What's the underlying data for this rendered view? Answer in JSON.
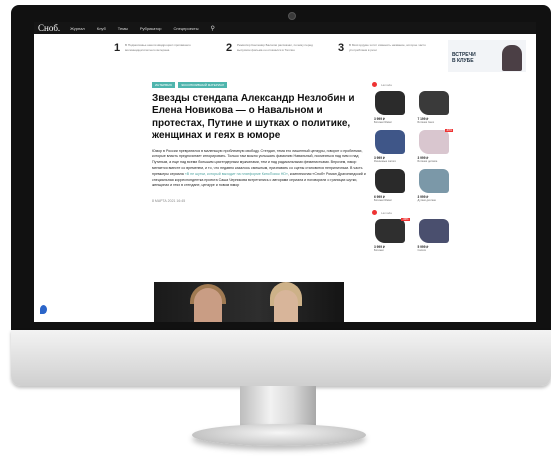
{
  "nav": {
    "logo": "Сноб.",
    "items": [
      "Журнал",
      "Клуб",
      "Темы",
      "Рубрикатор",
      "Спецпроекты"
    ]
  },
  "promo": [
    {
      "num": "1",
      "text": "В Подмосковье нашли квадроцикл пропавшего восемнадцатилетнего ветерана"
    },
    {
      "num": "2",
      "text": "Режиссёр Кантемир Балагов рассказал, почему перед выпуском фильма он отказался в Таллин"
    },
    {
      "num": "3",
      "text": "В Мосгордуме хотят изменить название, которое часто употребляем в речи"
    }
  ],
  "banner": {
    "text_line1": "ВСТРЕЧИ",
    "text_line2": "В КЛУБЕ"
  },
  "article": {
    "tags": [
      "ИНТЕРВЬЮ",
      "ЭКСКЛЮЗИВНЫЙ МАТЕРИАЛ"
    ],
    "headline": "Звезды стендапа Александр Незлобин и Елена Новикова — о Навальном и протестах, Путине и шутках о политике, женщинах и геях в юморе",
    "lead_part1": "Юмор в России превратился в маленькую проблемную свободу. Стендап, тема его лишенный цензуры, говорит о проблемах, которые власть предпочитает игнорировать. Только там можно услышать фамилию Навальный, посмеяться над ним и над Путиным, а еще над всеми большим цисгендерным мужчинами, тем и над радикальными феминистками. Впрочем, юмор меняется вместе со временем, и то, что недавно казалось смешным, признавать со сцены становится неприличным. В часть премьеры сериала ",
    "lead_link": "«В не шутки, который выходит на платформе КиноПоиск HD»",
    "lead_part2": ", комплексная «Сноб» Роман Драгоняндский и специальная корреспондентка проекта Саша Черникова встретились с авторами сериала и поговорили о границах шутки, женщинах и геях в стендапе, цензуре и новом юмор",
    "date": "8 МАРТА 2021 16:45"
  },
  "sidebar": {
    "store": "Lamoda",
    "shoes_top": [
      {
        "price": "3 999 ₽",
        "name": "Ботинки Rieker",
        "color": "#2b2b2b",
        "badge": ""
      },
      {
        "price": "7 199 ₽",
        "name": "Ботинки Geox",
        "color": "#3a3a3a",
        "badge": ""
      },
      {
        "price": "3 999 ₽",
        "name": "Резиновые сапоги",
        "color": "#3f5688",
        "badge": ""
      },
      {
        "price": "3 999 ₽",
        "name": "Ботинки детские",
        "color": "#d9c6cf",
        "badge": "-30%"
      },
      {
        "price": "6 999 ₽",
        "name": "Ботинки Rieker",
        "color": "#2a2a2a",
        "badge": ""
      },
      {
        "price": "3 999 ₽",
        "name": "Дутики детские",
        "color": "#7b98a8",
        "badge": ""
      }
    ],
    "shoes_bottom": [
      {
        "price": "3 999 ₽",
        "name": "Ботинки",
        "color": "#2f2f2f",
        "badge": "-30%"
      },
      {
        "price": "5 999 ₽",
        "name": "Сапоги",
        "color": "#4a4f6e",
        "badge": ""
      }
    ]
  }
}
